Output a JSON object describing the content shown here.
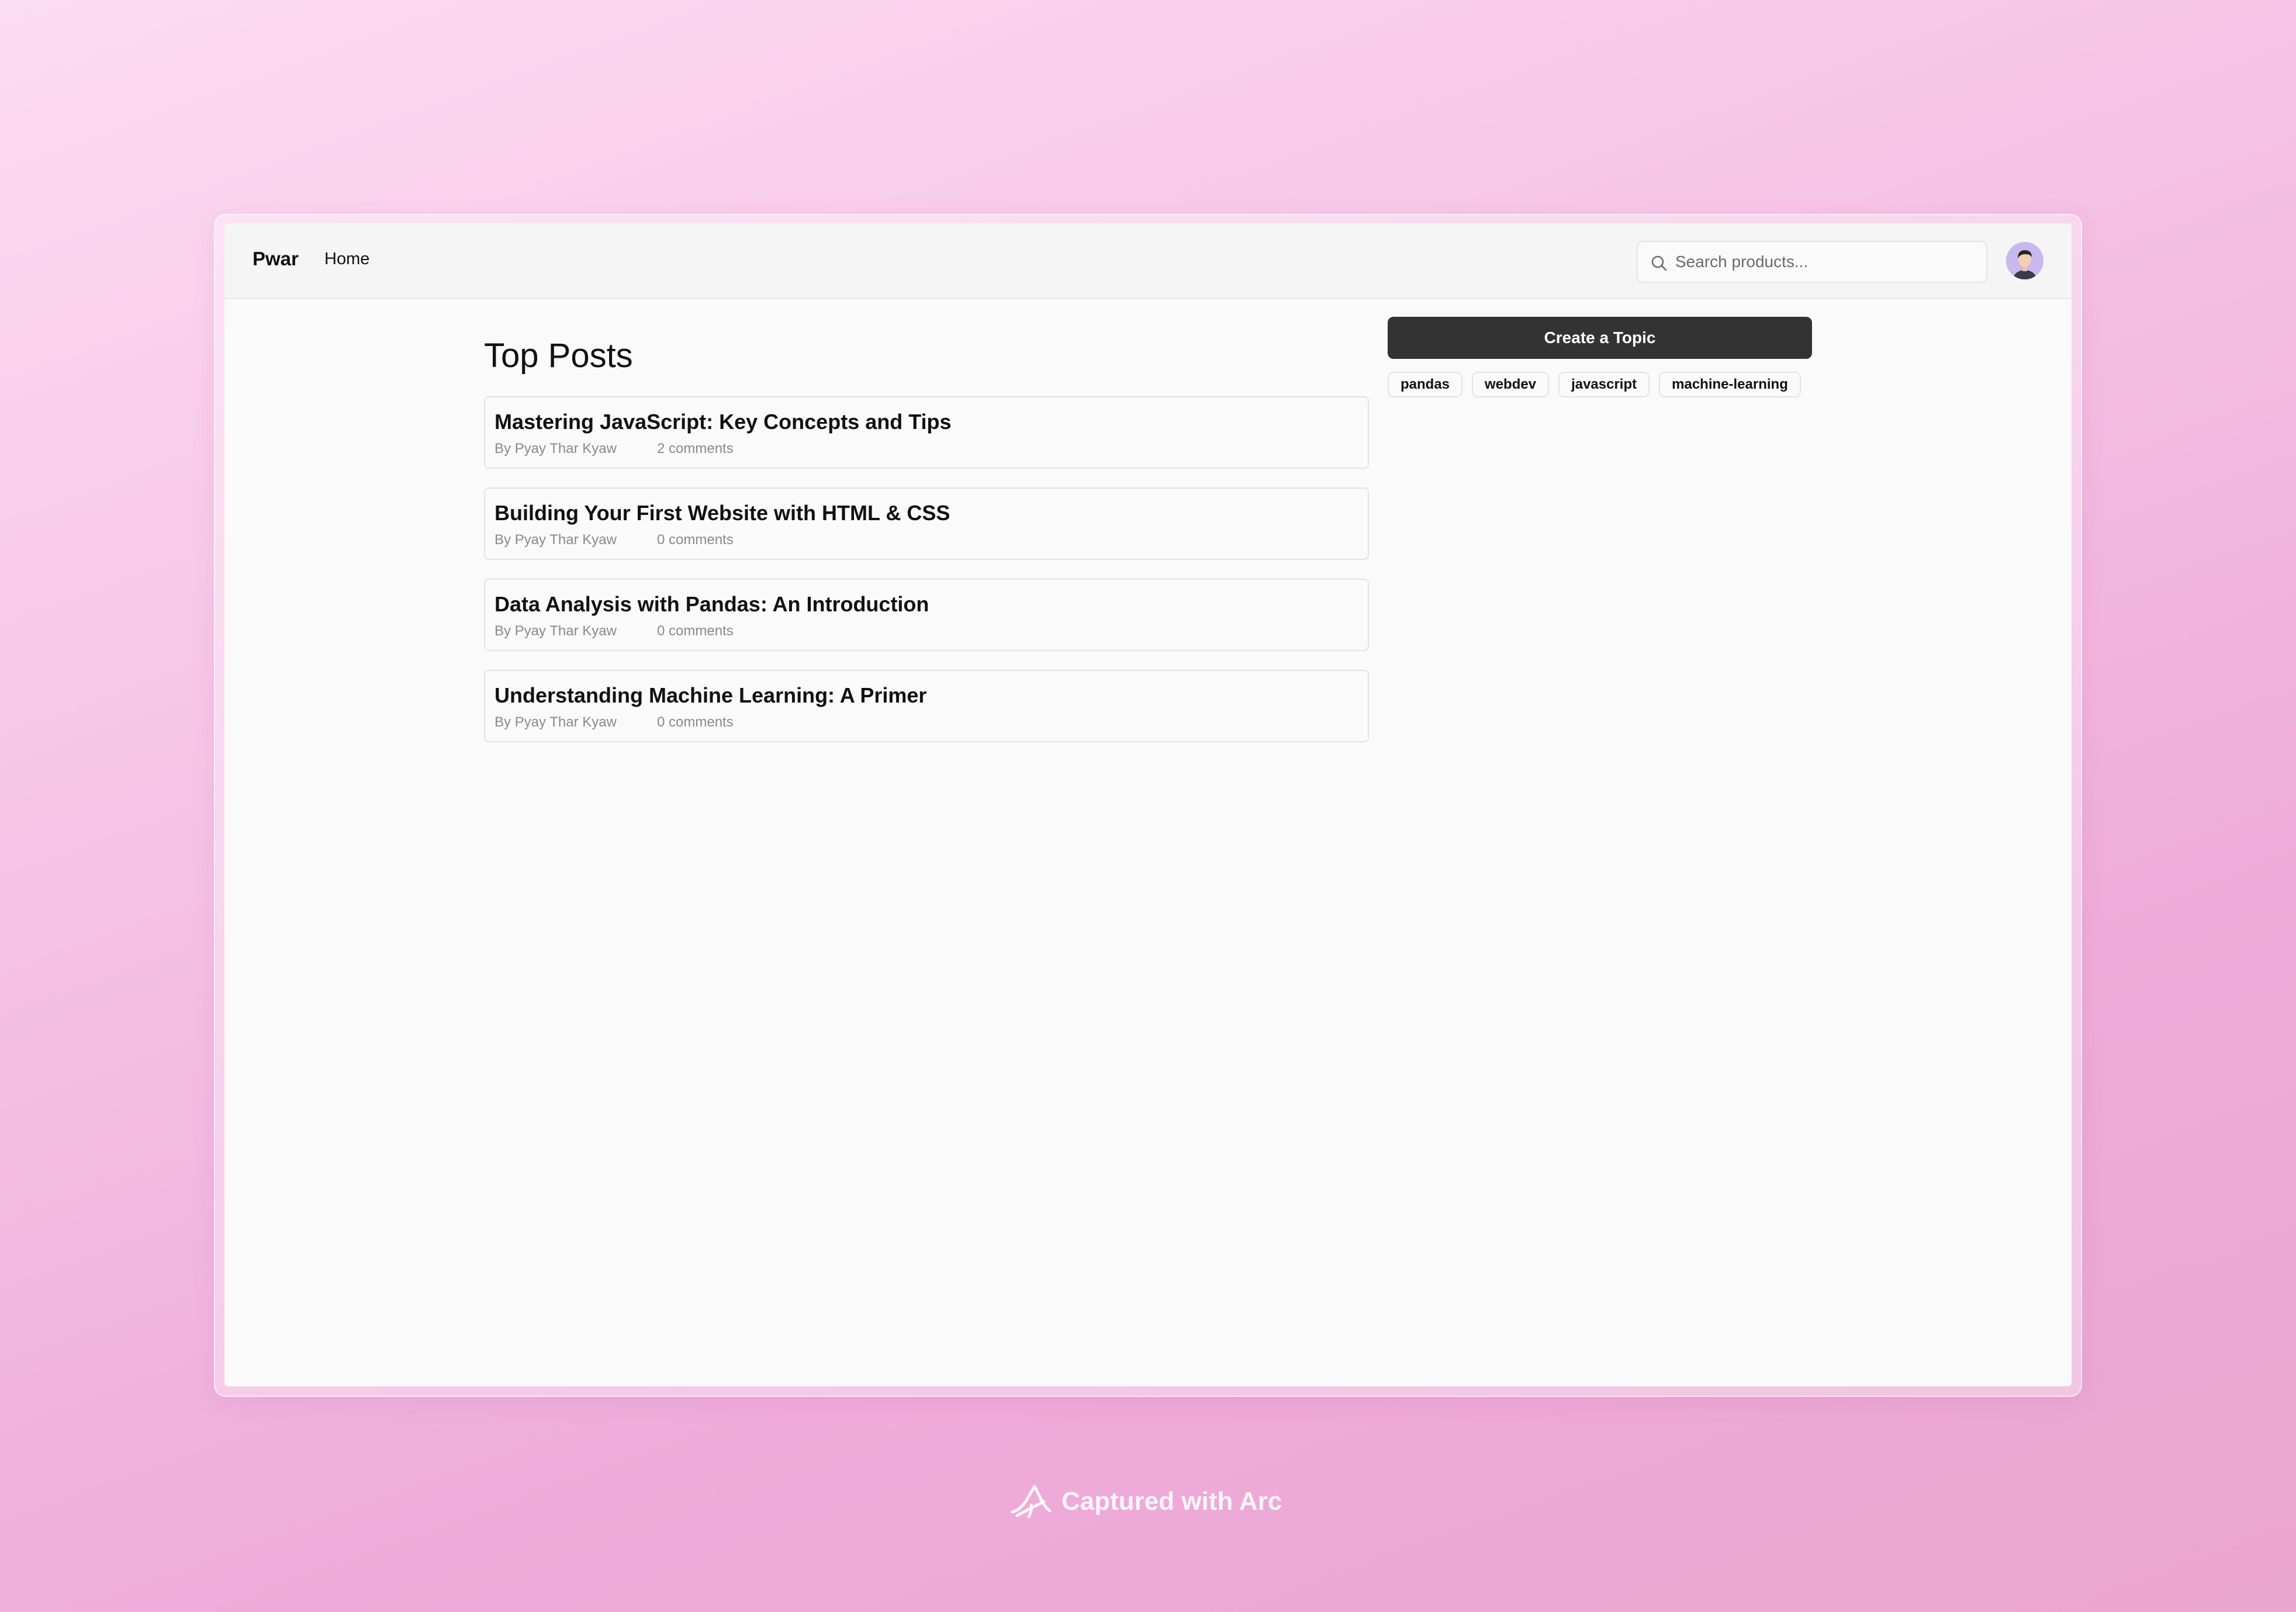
{
  "app": {
    "brand": "Pwar"
  },
  "nav": {
    "home_label": "Home"
  },
  "search": {
    "placeholder": "Search products...",
    "value": ""
  },
  "main": {
    "title": "Top Posts",
    "posts": [
      {
        "title": "Mastering JavaScript: Key Concepts and Tips",
        "author": "By Pyay Thar Kyaw",
        "comments": "2 comments"
      },
      {
        "title": "Building Your First Website with HTML & CSS",
        "author": "By Pyay Thar Kyaw",
        "comments": "0 comments"
      },
      {
        "title": "Data Analysis with Pandas: An Introduction",
        "author": "By Pyay Thar Kyaw",
        "comments": "0 comments"
      },
      {
        "title": "Understanding Machine Learning: A Primer",
        "author": "By Pyay Thar Kyaw",
        "comments": "0 comments"
      }
    ]
  },
  "sidebar": {
    "create_label": "Create a Topic",
    "tags": [
      "pandas",
      "webdev",
      "javascript",
      "machine-learning"
    ]
  },
  "watermark": {
    "text": "Captured with Arc"
  },
  "icons": {
    "search": "search-icon",
    "avatar": "user-avatar",
    "arc_logo": "arc-logo-icon"
  },
  "colors": {
    "primary_button": "#333333",
    "page_background": "#fafafa",
    "navbar_background": "#f5f5f5",
    "muted_text": "#8a8a8a",
    "avatar_background": "#c9b8f0"
  }
}
